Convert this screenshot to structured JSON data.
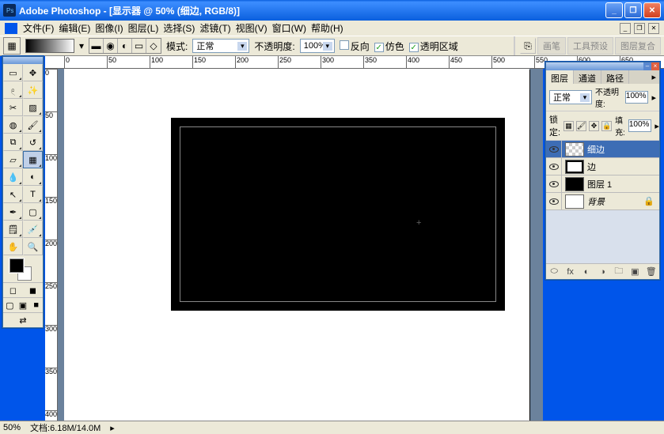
{
  "title": "Adobe Photoshop - [显示器 @ 50% (细边, RGB/8)]",
  "menus": [
    "文件(F)",
    "编辑(E)",
    "图像(I)",
    "图层(L)",
    "选择(S)",
    "滤镜(T)",
    "视图(V)",
    "窗口(W)",
    "帮助(H)"
  ],
  "options": {
    "mode_label": "模式:",
    "mode_value": "正常",
    "opacity_label": "不透明度:",
    "opacity_value": "100%",
    "cb_reverse": "反向",
    "cb_dither": "仿色",
    "cb_transparent": "透明区域",
    "dock_tabs": [
      "画笔",
      "工具预设",
      "图层复合"
    ]
  },
  "ruler_marks": [
    "0",
    "50",
    "100",
    "150",
    "200",
    "250",
    "300",
    "350",
    "400",
    "450",
    "500",
    "550",
    "600",
    "650"
  ],
  "ruler_v_marks": [
    "0",
    "50",
    "100",
    "150",
    "200",
    "250",
    "300",
    "350",
    "400"
  ],
  "panel": {
    "tabs": [
      "图层",
      "通道",
      "路径"
    ],
    "blend_mode": "正常",
    "opacity_label": "不透明度:",
    "opacity_value": "100%",
    "lock_label": "锁定:",
    "fill_label": "填充:",
    "fill_value": "100%",
    "layers": [
      {
        "name": "细边",
        "thumb": "checker",
        "active": true
      },
      {
        "name": "边",
        "thumb": "border",
        "active": false
      },
      {
        "name": "图层 1",
        "thumb": "black",
        "active": false
      },
      {
        "name": "背景",
        "thumb": "white",
        "active": false,
        "locked": true
      }
    ]
  },
  "status": {
    "zoom": "50%",
    "doc": "文档:6.18M/14.0M"
  }
}
